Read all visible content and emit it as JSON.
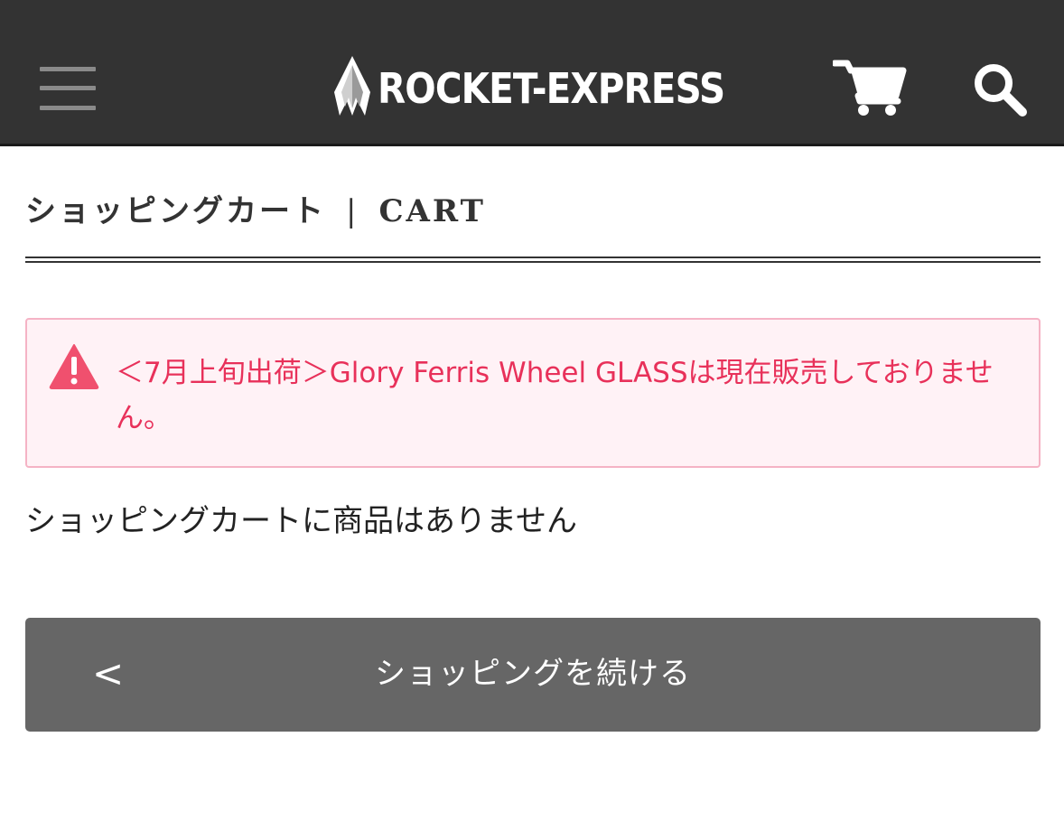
{
  "header": {
    "logo_text": "ROCKET-EXPRESS",
    "icons": {
      "menu": "hamburger-menu-icon",
      "cart": "shopping-cart-icon",
      "search": "search-icon",
      "logo": "rocket-flame-icon"
    },
    "background_color": "#333333"
  },
  "page": {
    "title_jp": "ショッピングカート",
    "title_separator": "|",
    "title_en": "CART"
  },
  "alert": {
    "icon": "warning-triangle-icon",
    "message": "＜7月上旬出荷＞Glory Ferris Wheel GLASSは現在販売しておりません。",
    "text_color": "#e8315a",
    "background_color": "#fff2f6",
    "border_color": "#f5b3c5"
  },
  "cart": {
    "empty_message": "ショッピングカートに商品はありません"
  },
  "continue_button": {
    "chevron": "<",
    "label": "ショッピングを続ける",
    "background_color": "#666666"
  }
}
